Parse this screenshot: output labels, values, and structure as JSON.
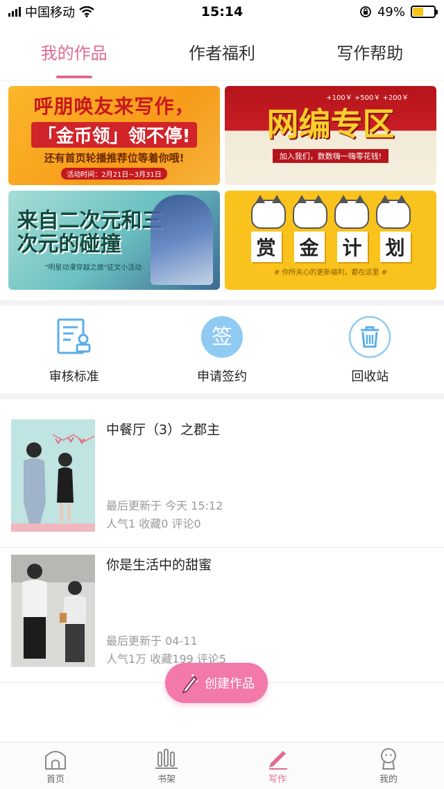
{
  "status_bar": {
    "carrier": "中国移动",
    "time": "15:14",
    "battery": "49%",
    "battery_level": 0.49
  },
  "top_tabs": [
    {
      "label": "我的作品",
      "active": true
    },
    {
      "label": "作者福利",
      "active": false
    },
    {
      "label": "写作帮助",
      "active": false
    }
  ],
  "banners": {
    "b1": {
      "line1": "呼朋唤友来写作，",
      "line2": "「金币领」领不停!",
      "line3": "还有首页轮播推荐位等着你哦!",
      "line4": "活动时间：2月21日~3月31日"
    },
    "b2": {
      "bonus": "+100￥ +500￥ +200￥",
      "title": "网编专区",
      "subtitle": "加入我们，数数嗨一嗨零花钱!"
    },
    "b3": {
      "title": "来自二次元和三次元的碰撞",
      "subtitle": "\"明星动漫穿越之旅\"征文小活动"
    },
    "b4": {
      "chars": [
        "赏",
        "金",
        "计",
        "划"
      ],
      "subtitle": "# 你所关心的更新福利，都在这里 #"
    }
  },
  "tools": [
    {
      "label": "审核标准",
      "icon": "document-review-icon"
    },
    {
      "label": "申请签约",
      "icon": "sign-contract-icon",
      "icon_text": "签"
    },
    {
      "label": "回收站",
      "icon": "trash-bin-icon"
    }
  ],
  "works": [
    {
      "title": "中餐厅（3）之郡主",
      "updated": "最后更新于  今天 15:12",
      "stats": "人气1  收藏0  评论0"
    },
    {
      "title": "你是生活中的甜蜜",
      "updated": "最后更新于  04-11",
      "stats": "人气1万  收藏199  评论5"
    }
  ],
  "fab": {
    "label": "创建作品",
    "icon": "pencil-icon"
  },
  "bottom_nav": [
    {
      "label": "首页",
      "icon": "home-icon",
      "active": false
    },
    {
      "label": "书架",
      "icon": "bookshelf-icon",
      "active": false
    },
    {
      "label": "写作",
      "icon": "pen-icon",
      "active": true
    },
    {
      "label": "我的",
      "icon": "profile-icon",
      "active": false
    }
  ],
  "colors": {
    "accent": "#e06a93",
    "fab": "#f279aa",
    "tool_blue": "#5aaee8"
  }
}
